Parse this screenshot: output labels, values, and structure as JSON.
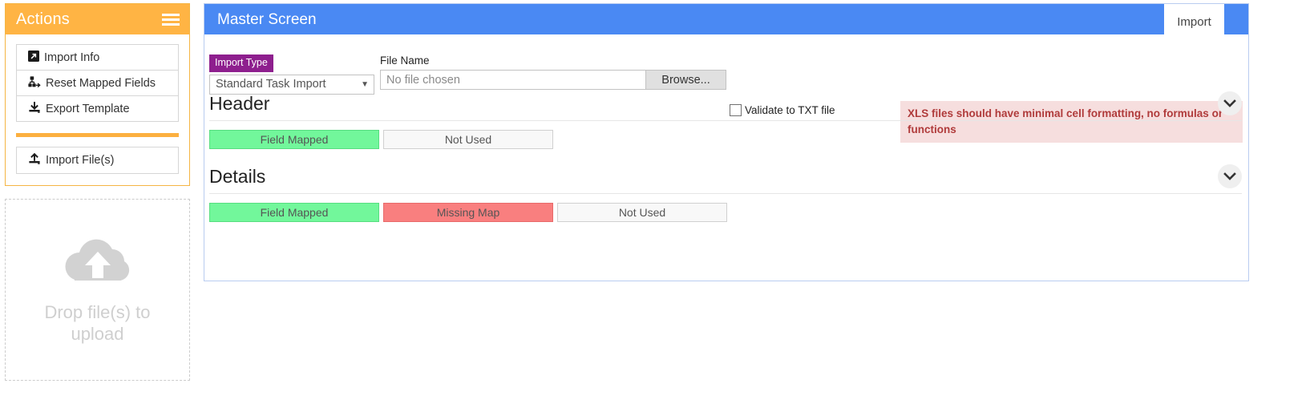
{
  "actions_panel": {
    "title": "Actions",
    "menu_icon": "hamburger-icon",
    "buttons": [
      {
        "label": "Import Info",
        "icon": "external-link-square-icon"
      },
      {
        "label": "Reset Mapped Fields",
        "icon": "sitemap-icon"
      },
      {
        "label": "Export Template",
        "icon": "download-icon"
      }
    ],
    "primary_button": {
      "label": "Import File(s)",
      "icon": "upload-icon"
    }
  },
  "dropzone": {
    "icon": "cloud-upload-icon",
    "text": "Drop file(s) to upload"
  },
  "main_panel": {
    "header_title": "Master Screen",
    "tab_label": "Import",
    "form": {
      "import_type_badge": "Import Type",
      "import_type_value": "Standard Task Import",
      "import_type_caret": "chevron-down-icon",
      "file_name_label": "File Name",
      "file_name_value": "No file chosen",
      "browse_label": "Browse...",
      "validate_checkbox_label": "Validate to TXT file",
      "validate_checkbox_checked": false,
      "warning_text": "XLS files should have minimal cell formatting, no formulas or functions"
    },
    "sections": [
      {
        "title": "Header",
        "collapse_icon": "chevron-down-icon",
        "legend": [
          {
            "label": "Field Mapped",
            "state": "green"
          },
          {
            "label": "Not Used",
            "state": "gray"
          }
        ]
      },
      {
        "title": "Details",
        "collapse_icon": "chevron-down-icon",
        "legend": [
          {
            "label": "Field Mapped",
            "state": "green"
          },
          {
            "label": "Missing Map",
            "state": "red"
          },
          {
            "label": "Not Used",
            "state": "gray"
          }
        ]
      }
    ]
  },
  "colors": {
    "accent_orange": "#ffb444",
    "header_blue": "#4a89f3",
    "badge_purple": "#8e1f8e",
    "mapped_green": "#72f79b",
    "missing_red": "#f97f7f",
    "not_used_gray": "#f8f8f8",
    "warning_bg": "#f6dede",
    "warning_text": "#b03b3b"
  }
}
